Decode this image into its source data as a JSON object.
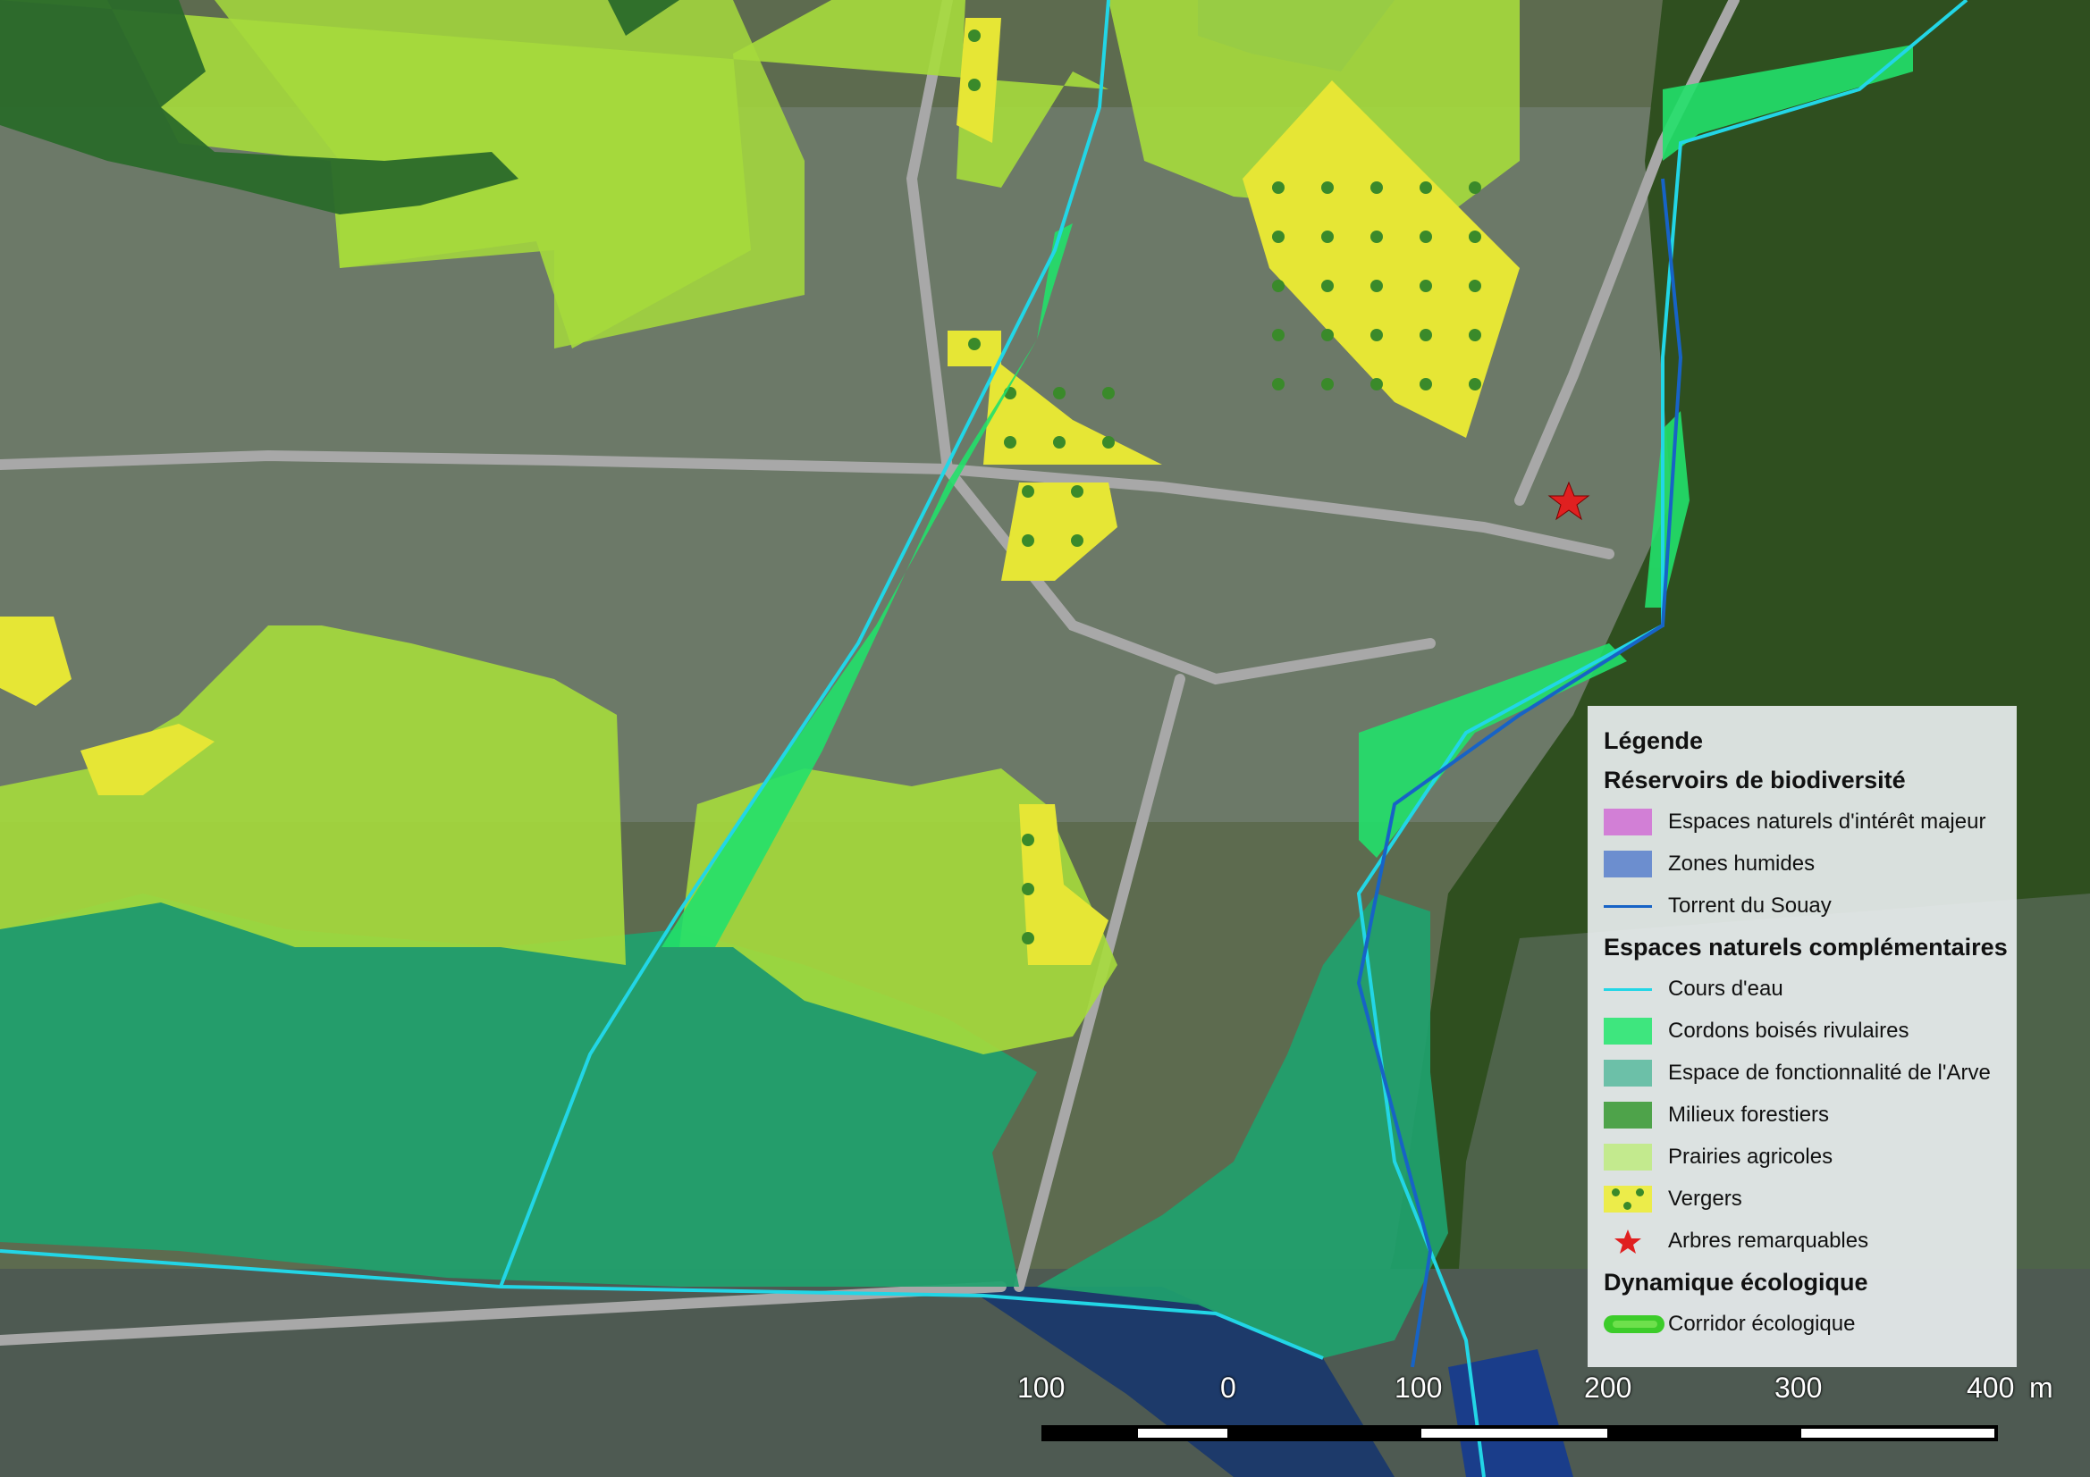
{
  "map": {
    "colors": {
      "forest_dark": "#2a6a2a",
      "forest_canopy": "#2f4f1f",
      "prairies": "#a6db3c",
      "vergers": "#e6e635",
      "vergers_dot": "#3a8a2a",
      "arve_fonctionnalite": "#1fa26e",
      "cordons": "#22e06a",
      "cours_eau": "#22d6e6",
      "souay": "#1763c6",
      "zones_humides": "#1a3d8a",
      "corridor": "#1fbf1f",
      "star": "#e02020",
      "road": "#9a9a9a",
      "urban": "#6f7b6c",
      "river_bed": "#1d3a4a"
    }
  },
  "legend": {
    "title": "Légende",
    "sections": [
      {
        "heading": "Réservoirs de biodiversité",
        "items": [
          {
            "label": "Espaces naturels d'intérêt majeur",
            "symbol": "fill",
            "color": "#d27fd6"
          },
          {
            "label": "Zones humides",
            "symbol": "fill",
            "color": "#6c8ecf"
          },
          {
            "label": "Torrent du Souay",
            "symbol": "line",
            "color": "#1763c6"
          }
        ]
      },
      {
        "heading": "Espaces naturels complémentaires",
        "items": [
          {
            "label": "Cours d'eau",
            "symbol": "line",
            "color": "#22d6e6"
          },
          {
            "label": "Cordons boisés rivulaires",
            "symbol": "fill",
            "color": "#3ee67e"
          },
          {
            "label": "Espace de fonctionnalité de l'Arve",
            "symbol": "fill",
            "color": "#6cc0a8"
          },
          {
            "label": "Milieux forestiers",
            "symbol": "fill",
            "color": "#4ea34a"
          },
          {
            "label": "Prairies agricoles",
            "symbol": "fill",
            "color": "#c3ea8e"
          },
          {
            "label": "Vergers",
            "symbol": "dots",
            "color": "#ecec4a"
          },
          {
            "label": "Arbres remarquables",
            "symbol": "star",
            "color": "#e02020"
          }
        ]
      },
      {
        "heading": "Dynamique écologique",
        "items": [
          {
            "label": "Corridor écologique",
            "symbol": "corridor",
            "color": "#3ccc2a"
          }
        ]
      }
    ]
  },
  "scalebar": {
    "labels": [
      "100",
      "0",
      "100",
      "200",
      "300",
      "400"
    ],
    "unit": "m"
  }
}
